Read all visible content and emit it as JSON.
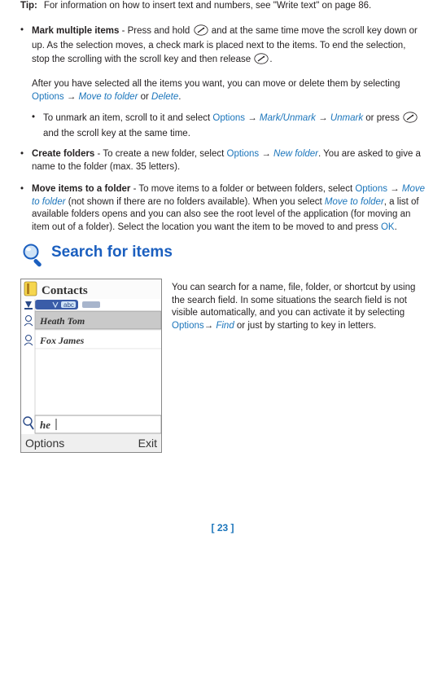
{
  "tip": {
    "label": "Tip:",
    "text_a": "For information on how to insert text and numbers, see \"Write text\" on page 86."
  },
  "mark_items": {
    "heading": "Mark multiple items",
    "text1a": " - Press and hold ",
    "text1b": " and at the same time move the scroll key down or up. As the selection moves, a check mark is placed next to the items. To end the selection, stop the scrolling with the scroll key and then release ",
    "text1c": ".",
    "text2a": "After you have selected all the items you want, you can move or delete them by selecting ",
    "options": "Options",
    "arrow": " → ",
    "move_to_folder": "Move to folder",
    "or": " or ",
    "delete": "Delete",
    "period": ".",
    "unmark_a": "To unmark an item, scroll to it and select ",
    "mark_unmark": "Mark/Unmark",
    "unmark": "Unmark",
    "unmark_b": " or press ",
    "unmark_c": " and the scroll key at the same time."
  },
  "create_folders": {
    "heading": "Create folders",
    "text_a": " - To create a new folder, select ",
    "options": "Options",
    "arrow": " → ",
    "new_folder": "New folder",
    "text_b": ". You are asked to give a name to the folder (max. 35 letters)."
  },
  "move_items": {
    "heading": "Move items to a folder",
    "text_a": " - To move items to a folder or between folders, select ",
    "options": "Options",
    "arrow": " → ",
    "move_to_folder": "Move to folder",
    "text_b": " (not shown if there are no folders available). When you select ",
    "text_c": ", a list of available folders opens and you can also see the root level of the application (for moving an item out of a folder). Select the location you want the item to be moved to and press ",
    "ok": "OK",
    "period": "."
  },
  "search_section": {
    "heading": "Search for items",
    "text_a": "You can search for a name, file, folder, or shortcut by using the search field. In some situations the search field is not visible automatically, and you can activate it by selecting ",
    "options": "Options",
    "arrow": "→ ",
    "find": "Find",
    "text_b": " or just by starting to key in letters."
  },
  "screenshot": {
    "title": "Contacts",
    "row1": "Heath Tom",
    "row2": "Fox James",
    "search_text": "he",
    "left_softkey": "Options",
    "right_softkey": "Exit",
    "abc": "abc"
  },
  "page_number": "[ 23 ]"
}
